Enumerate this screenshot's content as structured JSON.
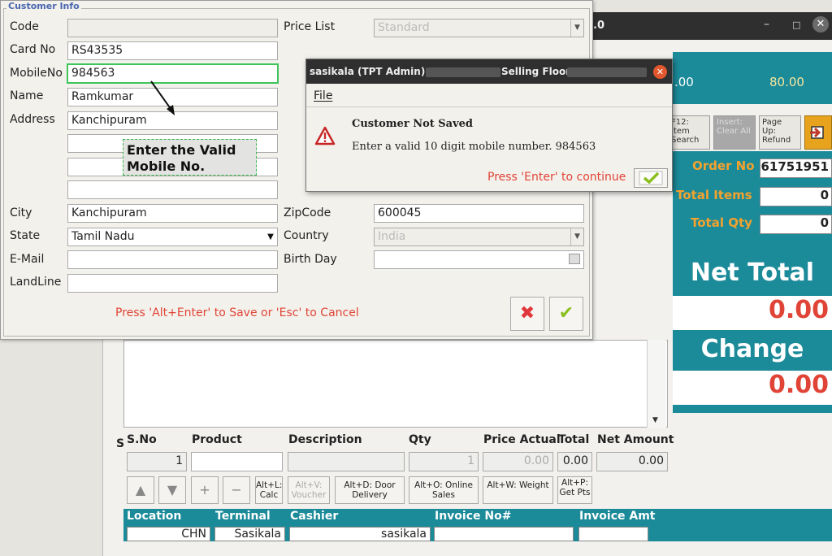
{
  "main_window": {
    "title_suffix": ".0",
    "min_icon": "–",
    "max_icon": "□",
    "close_icon": "✕",
    "top_val_a": ".00",
    "top_val_b": "80.00",
    "buttons": [
      {
        "label": "F12: Item Search"
      },
      {
        "label": "Insert: Clear All"
      },
      {
        "label": "Page Up: Refund"
      }
    ],
    "summary": {
      "order_no_label": "Order No",
      "order_no_value": "61751951",
      "total_items_label": "Total Items",
      "total_items_value": "0",
      "total_qty_label": "Total Qty",
      "total_qty_value": "0",
      "net_total_label": "Net Total",
      "net_total_value": "0.00",
      "change_label": "Change",
      "change_value": "0.00"
    },
    "grid_headers": {
      "sno": "S.No",
      "product": "Product",
      "description": "Description",
      "qty": "Qty",
      "price_actual": "Price Actual",
      "total": "Total",
      "net_amount": "Net Amount"
    },
    "entry_row": {
      "sno": "1",
      "qty": "1",
      "price_actual": "0.00",
      "total": "0.00",
      "net_amount": "0.00"
    },
    "side_letter": "S",
    "action_buttons": {
      "up": "▲",
      "down": "▼",
      "plus": "+",
      "minus": "−",
      "calc": "Alt+L: Calc",
      "voucher": "Alt+V: Voucher",
      "door_delivery": "Alt+D: Door Delivery",
      "online_sales": "Alt+O: Online Sales",
      "weight": "Alt+W: Weight",
      "get_pts": "Alt+P: Get Pts"
    },
    "bottom_bar": {
      "location_label": "Location",
      "location_value": "CHN",
      "terminal_label": "Terminal",
      "terminal_value": "Sasikala",
      "cashier_label": "Cashier",
      "cashier_value": "sasikala",
      "invoice_no_label": "Invoice No#",
      "invoice_amt_label": "Invoice Amt"
    }
  },
  "customer_dialog": {
    "legend": "Customer Info",
    "code_label": "Code",
    "card_no_label": "Card No",
    "card_no_value": "RS43535",
    "mobile_label": "MobileNo",
    "mobile_value": "984563",
    "name_label": "Name",
    "name_value": "Ramkumar",
    "address_label": "Address",
    "address_value": "Kanchipuram",
    "city_label": "City",
    "city_value": "Kanchipuram",
    "state_label": "State",
    "state_value": "Tamil Nadu",
    "email_label": "E-Mail",
    "landline_label": "LandLine",
    "price_list_label": "Price List",
    "price_list_value": "Standard",
    "zipcode_label": "ZipCode",
    "zipcode_value": "600045",
    "country_label": "Country",
    "country_value": "India",
    "birthday_label": "Birth Day",
    "annotation": "Enter the Valid Mobile No.",
    "save_hint": "Press 'Alt+Enter' to Save or 'Esc' to Cancel"
  },
  "error_dialog": {
    "title_user": "sasikala (TPT Admin) @",
    "title_section": "Selling Floor",
    "menu_file": "File",
    "heading": "Customer Not Saved",
    "message": "Enter a valid 10 digit mobile number. 984563",
    "hint": "Press 'Enter' to continue"
  },
  "colors": {
    "teal": "#1b8a99",
    "orange": "#f2a22e",
    "red": "#e04436",
    "green": "#3fc45a"
  }
}
